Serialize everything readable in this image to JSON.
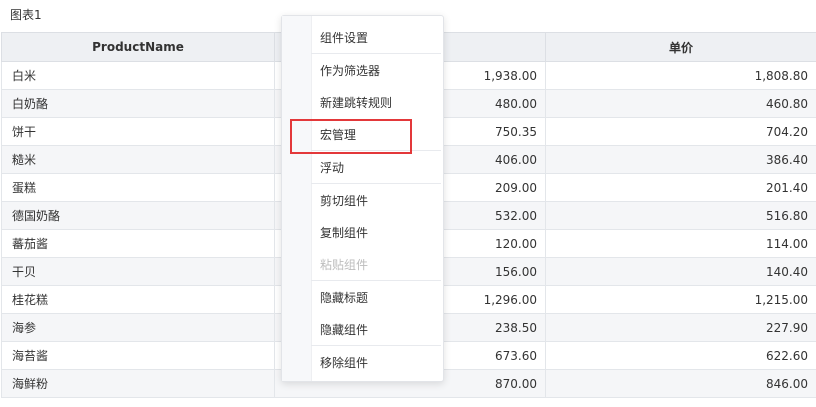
{
  "panel": {
    "title": "图表1"
  },
  "table": {
    "columns": [
      "ProductName",
      "",
      "单价"
    ],
    "rows": [
      [
        "白米",
        "1,938.00",
        "1,808.80"
      ],
      [
        "白奶酪",
        "480.00",
        "460.80"
      ],
      [
        "饼干",
        "750.35",
        "704.20"
      ],
      [
        "糙米",
        "406.00",
        "386.40"
      ],
      [
        "蛋糕",
        "209.00",
        "201.40"
      ],
      [
        "德国奶酪",
        "532.00",
        "516.80"
      ],
      [
        "蕃茄酱",
        "120.00",
        "114.00"
      ],
      [
        "干贝",
        "156.00",
        "140.40"
      ],
      [
        "桂花糕",
        "1,296.00",
        "1,215.00"
      ],
      [
        "海参",
        "238.50",
        "227.90"
      ],
      [
        "海苔酱",
        "673.60",
        "622.60"
      ],
      [
        "海鲜粉",
        "870.00",
        "846.00"
      ]
    ]
  },
  "context_menu": {
    "items": [
      {
        "label": "组件设置",
        "disabled": false
      },
      {
        "label": "作为筛选器",
        "disabled": false
      },
      {
        "label": "新建跳转规则",
        "disabled": false
      },
      {
        "label": "宏管理",
        "disabled": false,
        "highlighted": true
      },
      {
        "label": "浮动",
        "disabled": false
      },
      {
        "label": "剪切组件",
        "disabled": false
      },
      {
        "label": "复制组件",
        "disabled": false
      },
      {
        "label": "粘贴组件",
        "disabled": true
      },
      {
        "label": "隐藏标题",
        "disabled": false
      },
      {
        "label": "隐藏组件",
        "disabled": false
      },
      {
        "label": "移除组件",
        "disabled": false
      }
    ]
  },
  "colors": {
    "header_bg": "#eef0f3",
    "stripe_bg": "#f5f6f8",
    "highlight_border": "#e3383a",
    "disabled_text": "#bdbdbd"
  }
}
